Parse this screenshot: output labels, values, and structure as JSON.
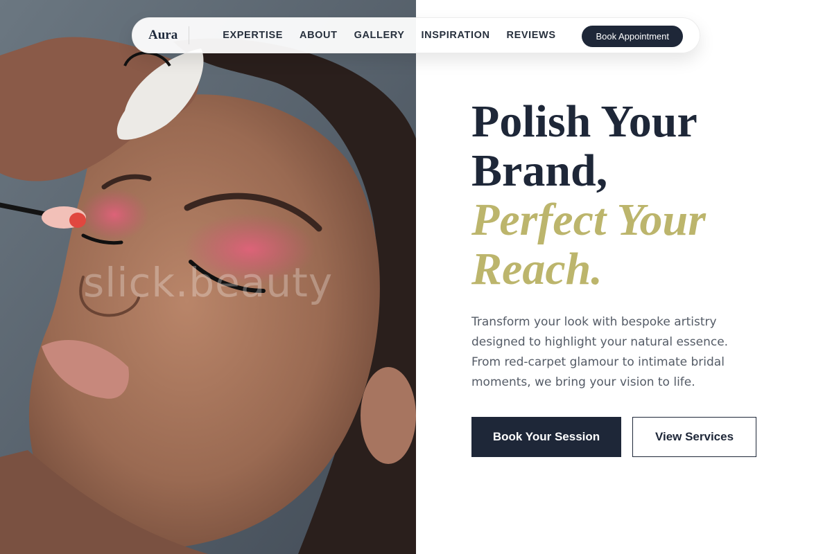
{
  "brand": {
    "name": "Aura"
  },
  "nav": {
    "links": [
      "EXPERTISE",
      "ABOUT",
      "GALLERY",
      "INSPIRATION",
      "REVIEWS"
    ],
    "cta_label": "Book Appointment"
  },
  "photo": {
    "subject": "makeup artist applying pink eyeshadow to a model",
    "watermark": "slick.beauty"
  },
  "hero": {
    "title_line1": "Polish Your",
    "title_line2": "Brand,",
    "title_line3": "Perfect Your",
    "title_line4": "Reach.",
    "paragraph": "Transform your look with bespoke artistry designed to highlight your natural essence. From red-carpet glamour to intimate bridal moments, we bring your vision to life.",
    "primary_button": "Book Your Session",
    "secondary_button": "View Services"
  },
  "colors": {
    "navy": "#1e2738",
    "gold_accent": "#bcb56c",
    "body_text": "#545b66",
    "background": "#ffffff"
  }
}
